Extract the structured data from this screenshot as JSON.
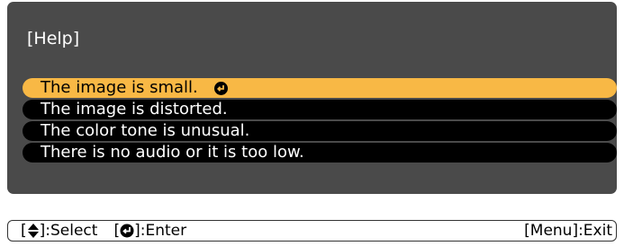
{
  "help": {
    "title": "[Help]",
    "items": [
      {
        "label": "The image is small.",
        "selected": true
      },
      {
        "label": "The image is distorted.",
        "selected": false
      },
      {
        "label": "The color tone is unusual.",
        "selected": false
      },
      {
        "label": "There is no audio or it is too low.",
        "selected": false
      }
    ]
  },
  "footer": {
    "select_open": "[",
    "select_close": "]:Select",
    "enter_open": "[",
    "enter_close": "]:Enter",
    "exit": "[Menu]:Exit",
    "select_icon": "up-down-arrow-icon",
    "enter_icon": "enter-icon"
  },
  "colors": {
    "panel_bg": "#4a4a4a",
    "item_bg": "#000000",
    "selected_bg": "#f8b845",
    "text": "#ffffff"
  }
}
